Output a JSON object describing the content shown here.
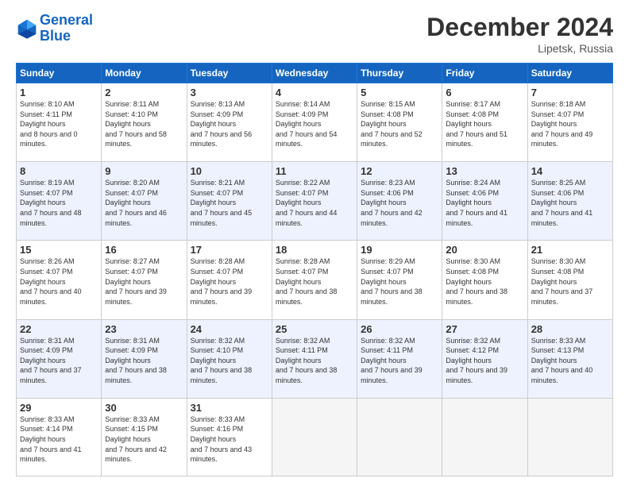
{
  "header": {
    "logo_line1": "General",
    "logo_line2": "Blue",
    "title": "December 2024",
    "location": "Lipetsk, Russia"
  },
  "days_of_week": [
    "Sunday",
    "Monday",
    "Tuesday",
    "Wednesday",
    "Thursday",
    "Friday",
    "Saturday"
  ],
  "weeks": [
    [
      {
        "num": "1",
        "sunrise": "8:10 AM",
        "sunset": "4:11 PM",
        "daylight": "8 hours and 0 minutes."
      },
      {
        "num": "2",
        "sunrise": "8:11 AM",
        "sunset": "4:10 PM",
        "daylight": "7 hours and 58 minutes."
      },
      {
        "num": "3",
        "sunrise": "8:13 AM",
        "sunset": "4:09 PM",
        "daylight": "7 hours and 56 minutes."
      },
      {
        "num": "4",
        "sunrise": "8:14 AM",
        "sunset": "4:09 PM",
        "daylight": "7 hours and 54 minutes."
      },
      {
        "num": "5",
        "sunrise": "8:15 AM",
        "sunset": "4:08 PM",
        "daylight": "7 hours and 52 minutes."
      },
      {
        "num": "6",
        "sunrise": "8:17 AM",
        "sunset": "4:08 PM",
        "daylight": "7 hours and 51 minutes."
      },
      {
        "num": "7",
        "sunrise": "8:18 AM",
        "sunset": "4:07 PM",
        "daylight": "7 hours and 49 minutes."
      }
    ],
    [
      {
        "num": "8",
        "sunrise": "8:19 AM",
        "sunset": "4:07 PM",
        "daylight": "7 hours and 48 minutes."
      },
      {
        "num": "9",
        "sunrise": "8:20 AM",
        "sunset": "4:07 PM",
        "daylight": "7 hours and 46 minutes."
      },
      {
        "num": "10",
        "sunrise": "8:21 AM",
        "sunset": "4:07 PM",
        "daylight": "7 hours and 45 minutes."
      },
      {
        "num": "11",
        "sunrise": "8:22 AM",
        "sunset": "4:07 PM",
        "daylight": "7 hours and 44 minutes."
      },
      {
        "num": "12",
        "sunrise": "8:23 AM",
        "sunset": "4:06 PM",
        "daylight": "7 hours and 42 minutes."
      },
      {
        "num": "13",
        "sunrise": "8:24 AM",
        "sunset": "4:06 PM",
        "daylight": "7 hours and 41 minutes."
      },
      {
        "num": "14",
        "sunrise": "8:25 AM",
        "sunset": "4:06 PM",
        "daylight": "7 hours and 41 minutes."
      }
    ],
    [
      {
        "num": "15",
        "sunrise": "8:26 AM",
        "sunset": "4:07 PM",
        "daylight": "7 hours and 40 minutes."
      },
      {
        "num": "16",
        "sunrise": "8:27 AM",
        "sunset": "4:07 PM",
        "daylight": "7 hours and 39 minutes."
      },
      {
        "num": "17",
        "sunrise": "8:28 AM",
        "sunset": "4:07 PM",
        "daylight": "7 hours and 39 minutes."
      },
      {
        "num": "18",
        "sunrise": "8:28 AM",
        "sunset": "4:07 PM",
        "daylight": "7 hours and 38 minutes."
      },
      {
        "num": "19",
        "sunrise": "8:29 AM",
        "sunset": "4:07 PM",
        "daylight": "7 hours and 38 minutes."
      },
      {
        "num": "20",
        "sunrise": "8:30 AM",
        "sunset": "4:08 PM",
        "daylight": "7 hours and 38 minutes."
      },
      {
        "num": "21",
        "sunrise": "8:30 AM",
        "sunset": "4:08 PM",
        "daylight": "7 hours and 37 minutes."
      }
    ],
    [
      {
        "num": "22",
        "sunrise": "8:31 AM",
        "sunset": "4:09 PM",
        "daylight": "7 hours and 37 minutes."
      },
      {
        "num": "23",
        "sunrise": "8:31 AM",
        "sunset": "4:09 PM",
        "daylight": "7 hours and 38 minutes."
      },
      {
        "num": "24",
        "sunrise": "8:32 AM",
        "sunset": "4:10 PM",
        "daylight": "7 hours and 38 minutes."
      },
      {
        "num": "25",
        "sunrise": "8:32 AM",
        "sunset": "4:11 PM",
        "daylight": "7 hours and 38 minutes."
      },
      {
        "num": "26",
        "sunrise": "8:32 AM",
        "sunset": "4:11 PM",
        "daylight": "7 hours and 39 minutes."
      },
      {
        "num": "27",
        "sunrise": "8:32 AM",
        "sunset": "4:12 PM",
        "daylight": "7 hours and 39 minutes."
      },
      {
        "num": "28",
        "sunrise": "8:33 AM",
        "sunset": "4:13 PM",
        "daylight": "7 hours and 40 minutes."
      }
    ],
    [
      {
        "num": "29",
        "sunrise": "8:33 AM",
        "sunset": "4:14 PM",
        "daylight": "7 hours and 41 minutes."
      },
      {
        "num": "30",
        "sunrise": "8:33 AM",
        "sunset": "4:15 PM",
        "daylight": "7 hours and 42 minutes."
      },
      {
        "num": "31",
        "sunrise": "8:33 AM",
        "sunset": "4:16 PM",
        "daylight": "7 hours and 43 minutes."
      },
      null,
      null,
      null,
      null
    ]
  ]
}
